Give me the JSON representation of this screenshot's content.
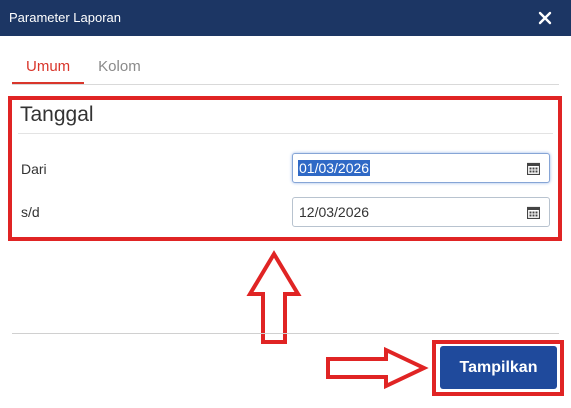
{
  "window": {
    "title": "Parameter Laporan"
  },
  "tabs": [
    {
      "label": "Umum",
      "active": true
    },
    {
      "label": "Kolom",
      "active": false
    }
  ],
  "section": {
    "title": "Tanggal"
  },
  "fields": {
    "from": {
      "label": "Dari",
      "value": "01/03/2026"
    },
    "to": {
      "label": "s/d",
      "value": "12/03/2026"
    }
  },
  "actions": {
    "submit_label": "Tampilkan"
  },
  "colors": {
    "titlebar": "#1c3664",
    "active_tab": "#d9362b",
    "primary_button": "#1f4a9c",
    "annotation": "#e02424"
  },
  "icons": {
    "close": "close-icon",
    "calendar": "calendar-icon"
  }
}
